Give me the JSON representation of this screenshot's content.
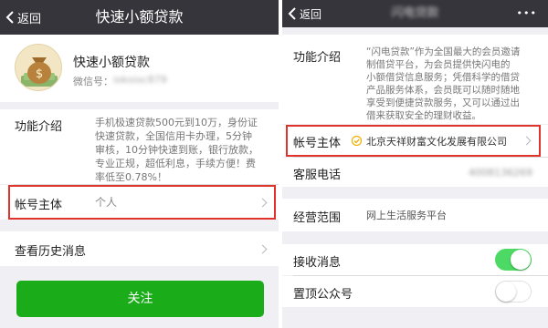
{
  "left": {
    "back_label": "返回",
    "title": "快速小额贷款",
    "account_name": "快速小额贷款",
    "wechat_label": "微信号：",
    "wechat_id": "ioksioc879",
    "intro_label": "功能介绍",
    "intro_lines": [
      "手机极速贷款500元到10万，身份证",
      "快速贷款，全国信用卡办理，5分钟",
      "审核，10分钟快速到账，银行放款，",
      "专业正规，超低利息，手续方便！费",
      "率低至0.78%！"
    ],
    "owner_label": "帐号主体",
    "owner_value": "个人",
    "history_label": "查看历史消息",
    "follow_label": "关注"
  },
  "right": {
    "back_label": "返回",
    "title": "闪电贷款",
    "more_label": "•••",
    "intro_label": "功能介绍",
    "intro_lines": [
      "“闪电贷款”作为全国最大的会员邀请",
      "制借贷平台，为会员提供快闪电的",
      "小额借贷信息服务；凭借科学的借贷",
      "产品服务体系，会员既可以随时随地",
      "享受到便捷贷款服务，又可以通过出",
      "借来获取安全的理财收益。"
    ],
    "owner_label": "帐号主体",
    "owner_value": "北京天祥财富文化发展有限公司",
    "service_label": "客服电话",
    "service_value": "4008136269",
    "scope_label": "经营范围",
    "scope_value": "网上生活服务平台",
    "receive_label": "接收消息",
    "receive_on": true,
    "pin_label": "置顶公众号",
    "pin_on": false
  },
  "colors": {
    "topbar": "#35353b",
    "follow_button": "#1aad19",
    "highlight_box": "#e0332b",
    "toggle_on": "#4cd964",
    "verified_badge": "#f0b000"
  }
}
